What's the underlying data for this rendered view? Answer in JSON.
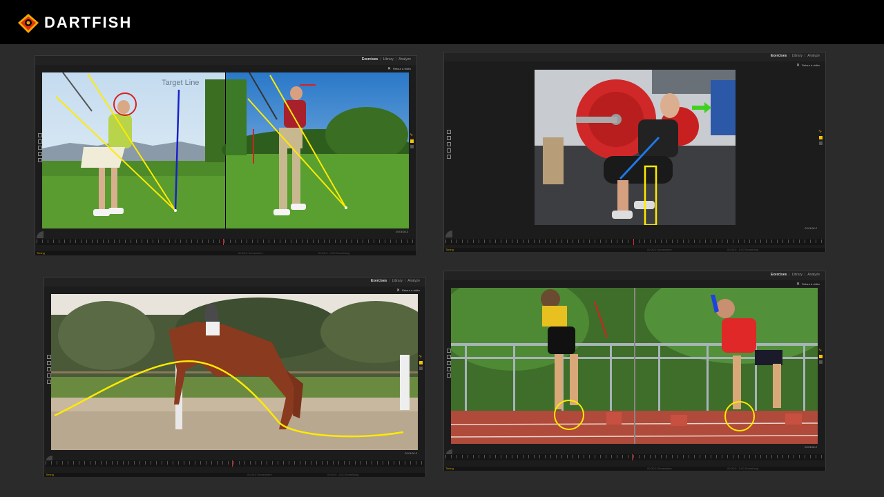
{
  "brand": {
    "name": "DARTFISH",
    "accent": "#f5a800"
  },
  "app": {
    "tabs": [
      "Exercises",
      "Library",
      "Analyze"
    ],
    "back_link": "Retour à vidéo",
    "timecode": "0:0:3:04.2",
    "status_left": "Timing",
    "status_mid": "00:00:0 Somewhere",
    "status_mid2": "00:00:0 - 0:00 Something"
  },
  "panels": [
    {
      "name": "golf",
      "overlay_text": "Target Line"
    },
    {
      "name": "weightlifting"
    },
    {
      "name": "horse"
    },
    {
      "name": "sprint"
    }
  ],
  "colors": {
    "annotation_yellow": "#ffea00",
    "annotation_red": "#d62020",
    "annotation_blue": "#1020c8",
    "play_controls": "#f5c400"
  }
}
